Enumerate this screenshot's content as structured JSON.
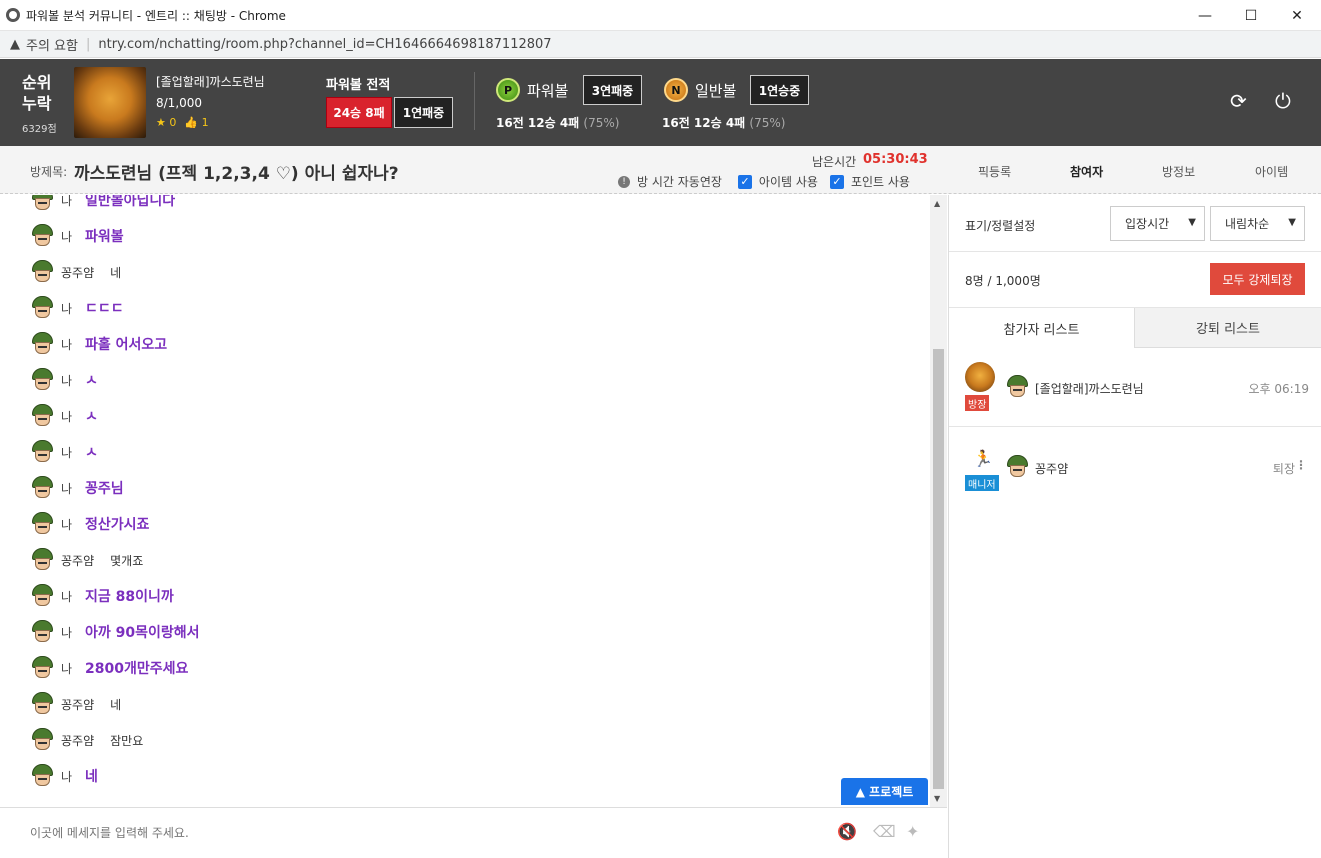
{
  "window": {
    "title": "파워볼 분석 커뮤니티 - 엔트리 :: 채팅방 - Chrome",
    "minimize": "—",
    "maximize": "☐",
    "close": "✕"
  },
  "address": {
    "warning": "주의 요함",
    "url": "ntry.com/nchatting/room.php?channel_id=CH1646664698187112807"
  },
  "header": {
    "rank_line1": "순위",
    "rank_line2": "누락",
    "points": "6329점",
    "host_name": "[졸업할래]까스도련님",
    "host_count": "8/1,000",
    "stars": "0",
    "likes": "1",
    "powerball_title": "파워볼 전적",
    "powerball_record": "24승 8패",
    "powerball_streak": "1연패중",
    "games": [
      {
        "coin": "P",
        "label": "파워볼",
        "streak": "3연패중",
        "stat": "16전 12승 4패",
        "pct": "(75%)"
      },
      {
        "coin": "N",
        "label": "일반볼",
        "streak": "1연승중",
        "stat": "16전 12승 4패",
        "pct": "(75%)"
      }
    ],
    "refresh": "⟳",
    "power": "⏻"
  },
  "room": {
    "label": "방제목:",
    "title": "까스도련님 (프젝 1,2,3,4 ♡) 아니 쉽자나?",
    "time_label": "남은시간",
    "time_value": "05:30:43",
    "auto_extend": "방 시간 자동연장",
    "item_use": "아이템 사용",
    "point_use": "포인트 사용",
    "tabs": [
      "픽등록",
      "참여자",
      "방정보",
      "아이템"
    ]
  },
  "messages": [
    {
      "who": "나",
      "me": true,
      "text": "일반볼아닙니다"
    },
    {
      "who": "나",
      "me": true,
      "text": "파워볼"
    },
    {
      "who": "꽁주얌",
      "me": false,
      "text": "네"
    },
    {
      "who": "나",
      "me": true,
      "text": "ㄷㄷㄷ"
    },
    {
      "who": "나",
      "me": true,
      "text": "파홀 어서오고"
    },
    {
      "who": "나",
      "me": true,
      "text": "ㅅ"
    },
    {
      "who": "나",
      "me": true,
      "text": "ㅅ"
    },
    {
      "who": "나",
      "me": true,
      "text": "ㅅ"
    },
    {
      "who": "나",
      "me": true,
      "text": "꽁주님"
    },
    {
      "who": "나",
      "me": true,
      "text": "정산가시죠"
    },
    {
      "who": "꽁주얌",
      "me": false,
      "text": "몇개죠"
    },
    {
      "who": "나",
      "me": true,
      "text": "지금 88이니까"
    },
    {
      "who": "나",
      "me": true,
      "text": "아까 90목이랑해서"
    },
    {
      "who": "나",
      "me": true,
      "text": "2800개만주세요"
    },
    {
      "who": "꽁주얌",
      "me": false,
      "text": "네"
    },
    {
      "who": "꽁주얌",
      "me": false,
      "text": "잠만요"
    },
    {
      "who": "나",
      "me": true,
      "text": "네"
    }
  ],
  "project_button": "▲ 프로젝트",
  "input": {
    "placeholder": "이곳에 메세지를 입력해 주세요."
  },
  "panel": {
    "sort_label": "표기/정렬설정",
    "sort_by": "입장시간",
    "sort_order": "내림차순",
    "count": "8명 / 1,000명",
    "kick_all": "모두 강제퇴장",
    "tab_participants": "참가자 리스트",
    "tab_kicked": "강퇴 리스트",
    "participants": [
      {
        "tag": "방장",
        "tag_color": "#e04a3c",
        "name": "[졸업할래]까스도련님",
        "right": "오후 06:19"
      },
      {
        "tag": "매니저",
        "tag_color": "#1a8fd6",
        "name": "꽁주얌",
        "right": "퇴장"
      }
    ]
  }
}
